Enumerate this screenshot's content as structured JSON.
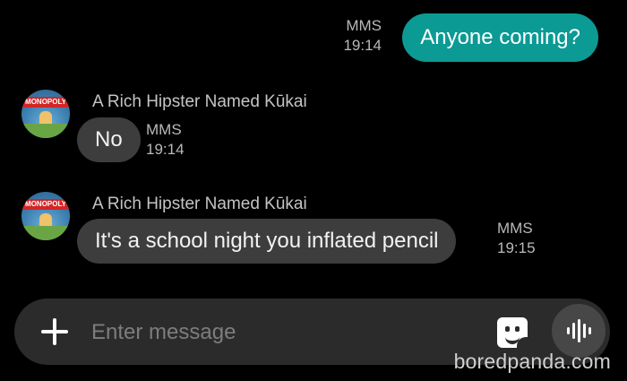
{
  "messages": {
    "outgoing": {
      "text": "Anyone coming?",
      "type": "MMS",
      "time": "19:14"
    },
    "incoming": [
      {
        "sender": "A Rich Hipster Named Kūkai",
        "avatar_logo": "MONOPOLY",
        "text": "No",
        "type": "MMS",
        "time": "19:14"
      },
      {
        "sender": "A Rich Hipster Named Kūkai",
        "avatar_logo": "MONOPOLY",
        "text": "It's a school night you inflated pencil",
        "type": "MMS",
        "time": "19:15"
      }
    ]
  },
  "composer": {
    "placeholder": "Enter message",
    "icons": {
      "add": "plus-icon",
      "sticker": "sticker-icon",
      "voice": "voice-waveform-icon"
    }
  },
  "watermark": "boredpanda.com",
  "colors": {
    "background": "#000000",
    "outgoing_bubble": "#0c9a94",
    "incoming_bubble": "#3d3d3d",
    "composer": "#2b2b2b",
    "voice_button": "#474747"
  }
}
